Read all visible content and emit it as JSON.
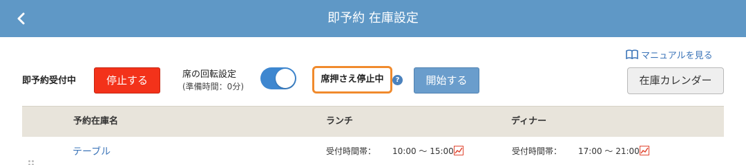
{
  "header": {
    "title": "即予約 在庫設定"
  },
  "manual": {
    "label": "マニュアルを見る"
  },
  "controls": {
    "accepting_label": "即予約受付中",
    "stop_button": "停止する",
    "rotation_title": "席の回転設定",
    "rotation_sub": "(準備時間：0分)",
    "rotation_enabled": true,
    "seat_pause_label": "席押さえ停止中",
    "help_glyph": "?",
    "start_button": "開始する",
    "calendar_button": "在庫カレンダー"
  },
  "table": {
    "columns": {
      "name": "予約在庫名",
      "lunch": "ランチ",
      "dinner": "ディナー"
    },
    "rows": [
      {
        "name": "テーブル",
        "lunch": {
          "label": "受付時間帯：",
          "time": "10:00 〜 15:00"
        },
        "dinner": {
          "label": "受付時間帯：",
          "time": "17:00 〜 21:00"
        }
      }
    ]
  },
  "colors": {
    "header_bg": "#5f98c6",
    "stop_red": "#f3321a",
    "start_blue": "#6a9dcc",
    "highlight_orange": "#f08a2c",
    "link_blue": "#3b74b8",
    "table_head_bg": "#e8e4db"
  },
  "icons": [
    "chevron-left-icon",
    "book-icon",
    "help-icon",
    "chart-icon"
  ]
}
